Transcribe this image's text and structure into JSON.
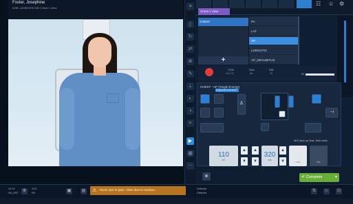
{
  "patient": {
    "name": "Foster, Josephine",
    "info": "DOB: 12/08/1976     SID: Chest 1 View"
  },
  "procedure_tab": "Chest 1 View",
  "exams": [
    {
      "label": "CHEST",
      "selected": true
    }
  ],
  "views": [
    {
      "label": "PA",
      "selected": false
    },
    {
      "label": "LAT",
      "selected": false
    },
    {
      "label": "AP",
      "selected": true
    },
    {
      "label": "LORDOTIC",
      "selected": false
    },
    {
      "label": "AP_DECUBITUS",
      "selected": false
    }
  ],
  "add_label": "+",
  "info": {
    "fov_label": "FOV",
    "fov_val": "14 X 17",
    "grid_label": "Grid",
    "grid_val": "40",
    "sid_label": "SID",
    "sid_val": "72",
    "di_label": "DI"
  },
  "settings": {
    "title": "CHEST - AP (Single Energy)",
    "tag": "Suggested Collimation",
    "aec_label": "AEC",
    "body_label": "Body",
    "kv": {
      "value": "110",
      "unit": "kV"
    },
    "mas": {
      "value": "320",
      "unit": "mA"
    },
    "mas_label": "mAs",
    "sec_label": "Sec",
    "backup": "AEC Back up Time: 1000 mSec"
  },
  "complete_label": "Complete",
  "status": {
    "left1": "12:19",
    "left2": "NO_PAT",
    "mid1": "1/12",
    "mid2": "0/0",
    "warning": "Room door is open. Close door to continue.",
    "right1": "Detector",
    "right2": "Detector"
  },
  "colors": {
    "accent": "#2c7fd6",
    "complete": "#6aae3a",
    "warning": "#b67420",
    "tab": "#7c5cc4"
  }
}
